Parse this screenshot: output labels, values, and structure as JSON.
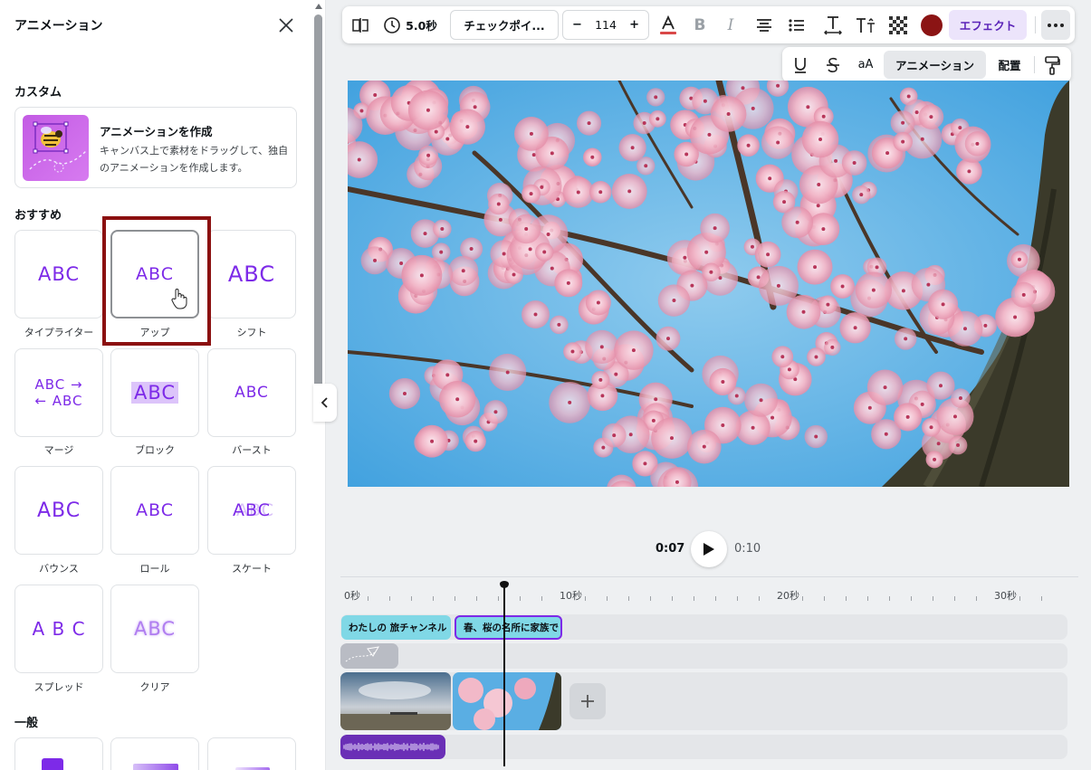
{
  "panel": {
    "title": "アニメーション",
    "custom_section": "カスタム",
    "custom_card": {
      "title": "アニメーションを作成",
      "description": "キャンバス上で素材をドラッグして、独自のアニメーションを作成します。"
    },
    "recommended_section": "おすすめ",
    "animations": [
      {
        "label": "タイプライター",
        "art": "ABC"
      },
      {
        "label": "アップ",
        "art": "ABC"
      },
      {
        "label": "シフト",
        "art": "ABC"
      },
      {
        "label": "マージ",
        "art": "ABC → ← ABC"
      },
      {
        "label": "ブロック",
        "art": "ABC"
      },
      {
        "label": "バースト",
        "art": "ABC"
      },
      {
        "label": "バウンス",
        "art": "ABC"
      },
      {
        "label": "ロール",
        "art": "ABC"
      },
      {
        "label": "スケート",
        "art": "ABC"
      },
      {
        "label": "スプレッド",
        "art": "A B C"
      },
      {
        "label": "クリア",
        "art": "ABC"
      }
    ],
    "general_section": "一般"
  },
  "toolbar": {
    "duration": "5.0秒",
    "checkpoint": "チェックポイ...",
    "minus": "−",
    "font_size": "114",
    "plus": "+",
    "effects": "エフェクト",
    "text_color": "#8b1414"
  },
  "toolbar2": {
    "case": "aA",
    "animation": "アニメーション",
    "position": "配置"
  },
  "playback": {
    "current": "0:07",
    "total": "0:10"
  },
  "timeline": {
    "ruler": [
      "0秒",
      "10秒",
      "20秒",
      "30秒"
    ],
    "text_clips": [
      "わたしの 旅チャンネル",
      "春、桜の名所に家族で"
    ]
  },
  "colors": {
    "accent": "#7d2ae8",
    "highlight": "#8b1010"
  }
}
